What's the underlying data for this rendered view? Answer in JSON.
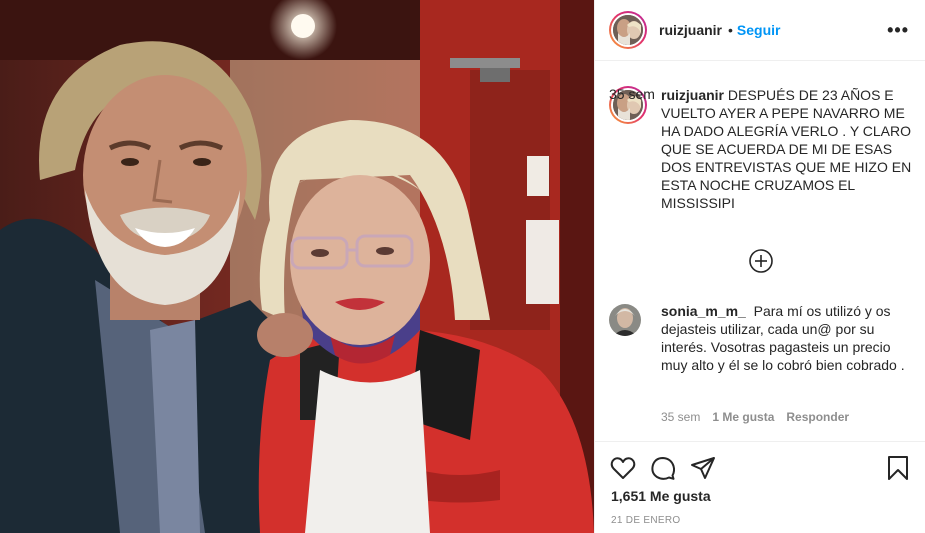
{
  "post": {
    "photo_icon": "selfie-photo"
  },
  "header": {
    "username": "ruizjuanir",
    "separator": "•",
    "follow_label": "Seguir",
    "more_label": "•••"
  },
  "caption": {
    "username": "ruizjuanir",
    "text": "DESPUÉS DE 23 AÑOS E VUELTO AYER A PEPE NAVARRO ME HA DADO ALEGRÍA VERLO . Y CLARO QUE SE ACUERDA DE MI DE ESAS DOS ENTREVISTAS QUE ME HIZO EN ESTA NOCHE CRUZAMOS EL MISSISSIPI",
    "time": "35 sem"
  },
  "load_more_icon": "plus-circle-icon",
  "comment": {
    "username": "sonia_m_m_",
    "text": "Para mí os utilizó y os dejasteis utilizar, cada un@ por su interés. Vosotras pagasteis un precio muy alto y él se lo cobró bien cobrado .",
    "time": "35 sem",
    "likes": "1 Me gusta",
    "reply": "Responder"
  },
  "actions": {
    "like_icon": "heart-icon",
    "comment_icon": "comment-icon",
    "share_icon": "share-icon",
    "save_icon": "bookmark-icon"
  },
  "likes_count": "1,651 Me gusta",
  "date": "21 DE ENERO",
  "colors": {
    "accent": "#0095f6",
    "text": "#262626",
    "secondary": "#8e8e8e",
    "border": "#efefef"
  }
}
